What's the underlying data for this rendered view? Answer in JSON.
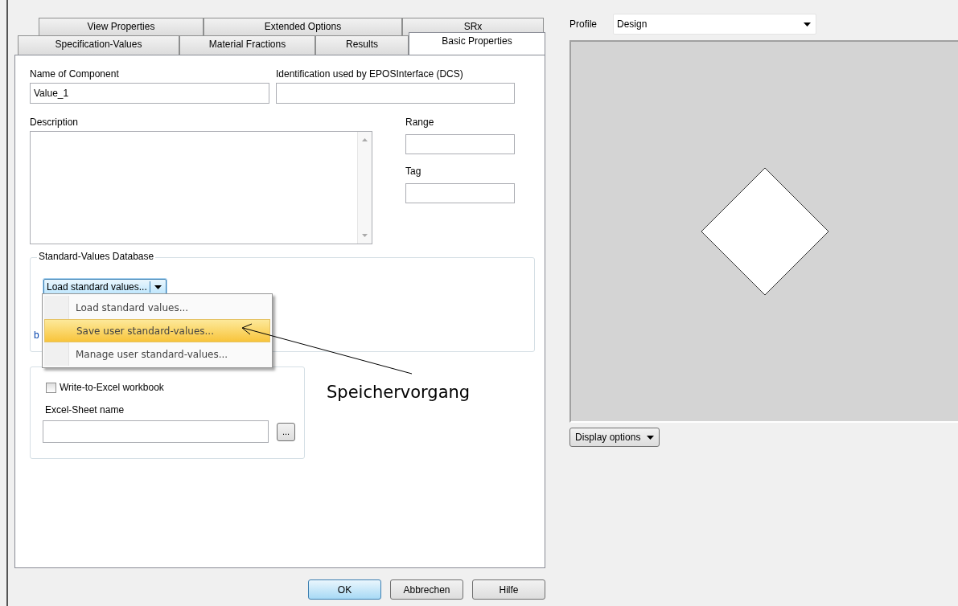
{
  "tab_rows": [
    [
      {
        "label": "View Properties",
        "selected": false
      },
      {
        "label": "Extended Options",
        "selected": false
      },
      {
        "label": "SRx",
        "selected": false
      }
    ],
    [
      {
        "label": "Specification-Values",
        "selected": false
      },
      {
        "label": "Material Fractions",
        "selected": false
      },
      {
        "label": "Results",
        "selected": false
      },
      {
        "label": "Basic Properties",
        "selected": true
      }
    ]
  ],
  "name_of_component": {
    "label": "Name of Component",
    "value": "Value_1"
  },
  "identification": {
    "label": "Identification used by EPOSInterface (DCS)"
  },
  "description": {
    "label": "Description"
  },
  "range": {
    "label": "Range"
  },
  "tag": {
    "label": "Tag"
  },
  "standard_values": {
    "title": "Standard-Values Database",
    "combo": "Load standard values...",
    "link": "b",
    "menu": [
      {
        "label": "Load standard values...",
        "selected": false
      },
      {
        "label": "Save user standard-values...",
        "selected": true
      },
      {
        "label": "Manage user standard-values...",
        "selected": false
      }
    ]
  },
  "excel": {
    "checkbox": {
      "label": "Write-to-Excel workbook",
      "checked": false
    },
    "sheet_label": "Excel-Sheet name",
    "browse": "..."
  },
  "annotation": "Speichervorgang",
  "buttons": [
    "OK",
    "Abbrechen",
    "Hilfe"
  ],
  "profile": {
    "label": "Profile",
    "value": "Design"
  },
  "display_options": "Display options"
}
